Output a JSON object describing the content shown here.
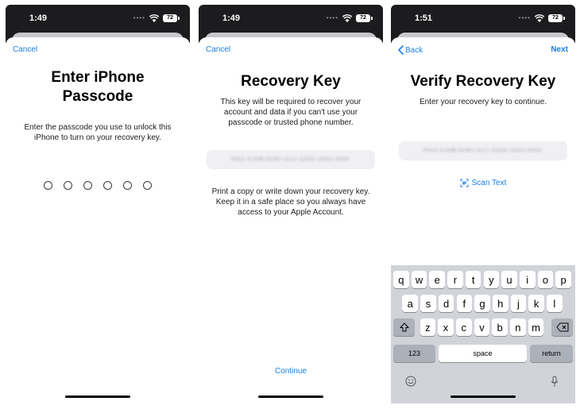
{
  "screens": {
    "passcode": {
      "time": "1:49",
      "battery": "72",
      "cancel_label": "Cancel",
      "title_line1": "Enter iPhone",
      "title_line2": "Passcode",
      "desc_line1": "Enter the passcode you use to unlock this",
      "desc_line2": "iPhone to turn on your recovery key.",
      "passcode_digits": 6
    },
    "recovery_key": {
      "time": "1:49",
      "battery": "72",
      "cancel_label": "Cancel",
      "title": "Recovery Key",
      "desc_line1": "This key will be required to recover your",
      "desc_line2": "account and data if you can't use your",
      "desc_line3": "passcode or trusted phone number.",
      "key_blurred": "P5LC-4TOW-XXWT-5L2T-G2GC-2XG2-XNXF",
      "note_line1": "Print a copy or write down your recovery key.",
      "note_line2": "Keep it in a safe place so you always have",
      "note_line3": "access to your Apple Account.",
      "continue_label": "Continue"
    },
    "verify": {
      "time": "1:51",
      "battery": "72",
      "back_label": "Back",
      "next_label": "Next",
      "title": "Verify Recovery Key",
      "desc": "Enter your recovery key to continue.",
      "key_blurred": "P5LC-4TOW-XXWT-5L2T-G2GC-2XG2-XNXF",
      "scan_label": "Scan Text"
    }
  },
  "keyboard": {
    "row1": [
      "q",
      "w",
      "e",
      "r",
      "t",
      "y",
      "u",
      "i",
      "o",
      "p"
    ],
    "row2": [
      "a",
      "s",
      "d",
      "f",
      "g",
      "h",
      "j",
      "k",
      "l"
    ],
    "row3": [
      "z",
      "x",
      "c",
      "v",
      "b",
      "n",
      "m"
    ],
    "numbers_label": "123",
    "space_label": "space",
    "return_label": "return"
  },
  "colors": {
    "accent": "#1a7fe4",
    "status_bar": "#1c1c1e",
    "keyboard_bg": "#d1d3d9",
    "key_dark": "#acb0b9"
  }
}
